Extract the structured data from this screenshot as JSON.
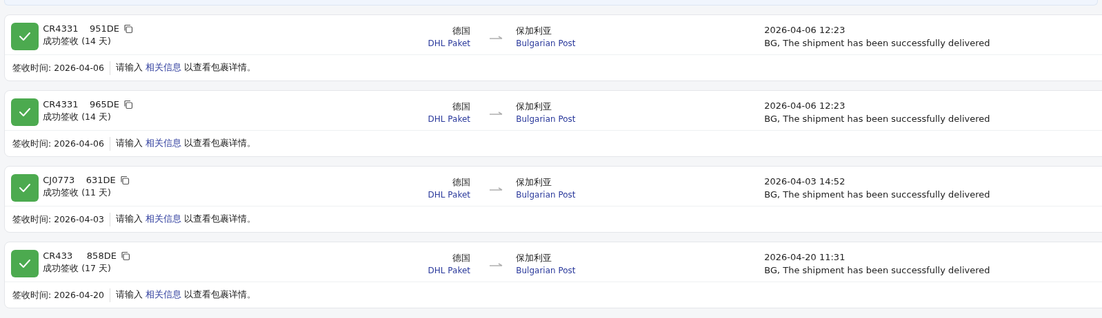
{
  "shipments": [
    {
      "tracking": "CR4331    951DE",
      "status": "成功签收 (14 天)",
      "delivered": true,
      "origin": "德国",
      "origin_carrier": "DHL Paket",
      "destination": "保加利亚",
      "destination_carrier": "Bulgarian Post",
      "event_time": "2026-04-06 12:23",
      "event": "BG, The shipment has been successfully delivered",
      "received_label": "签收时间: 2026-04-06",
      "hint_before": "请输入",
      "hint_link": "相关信息",
      "hint_after": "以查看包裹详情。"
    },
    {
      "tracking": "CR4331    965DE",
      "status": "成功签收 (14 天)",
      "delivered": true,
      "origin": "德国",
      "origin_carrier": "DHL Paket",
      "destination": "保加利亚",
      "destination_carrier": "Bulgarian Post",
      "event_time": "2026-04-06 12:23",
      "event": "BG, The shipment has been successfully delivered",
      "received_label": "签收时间: 2026-04-06",
      "hint_before": "请输入",
      "hint_link": "相关信息",
      "hint_after": "以查看包裹详情。"
    },
    {
      "tracking": "CJ0773    631DE",
      "status": "成功签收 (11 天)",
      "delivered": true,
      "origin": "德国",
      "origin_carrier": "DHL Paket",
      "destination": "保加利亚",
      "destination_carrier": "Bulgarian Post",
      "event_time": "2026-04-03 14:52",
      "event": "BG, The shipment has been successfully delivered",
      "received_label": "签收时间: 2026-04-03",
      "hint_before": "请输入",
      "hint_link": "相关信息",
      "hint_after": "以查看包裹详情。"
    },
    {
      "tracking": "CR433     858DE",
      "status": "成功签收 (17 天)",
      "delivered": true,
      "origin": "德国",
      "origin_carrier": "DHL Paket",
      "destination": "保加利亚",
      "destination_carrier": "Bulgarian Post",
      "event_time": "2026-04-20 11:31",
      "event": "BG, The shipment has been successfully delivered",
      "received_label": "签收时间: 2026-04-20",
      "hint_before": "请输入",
      "hint_link": "相关信息",
      "hint_after": "以查看包裹详情。"
    }
  ]
}
